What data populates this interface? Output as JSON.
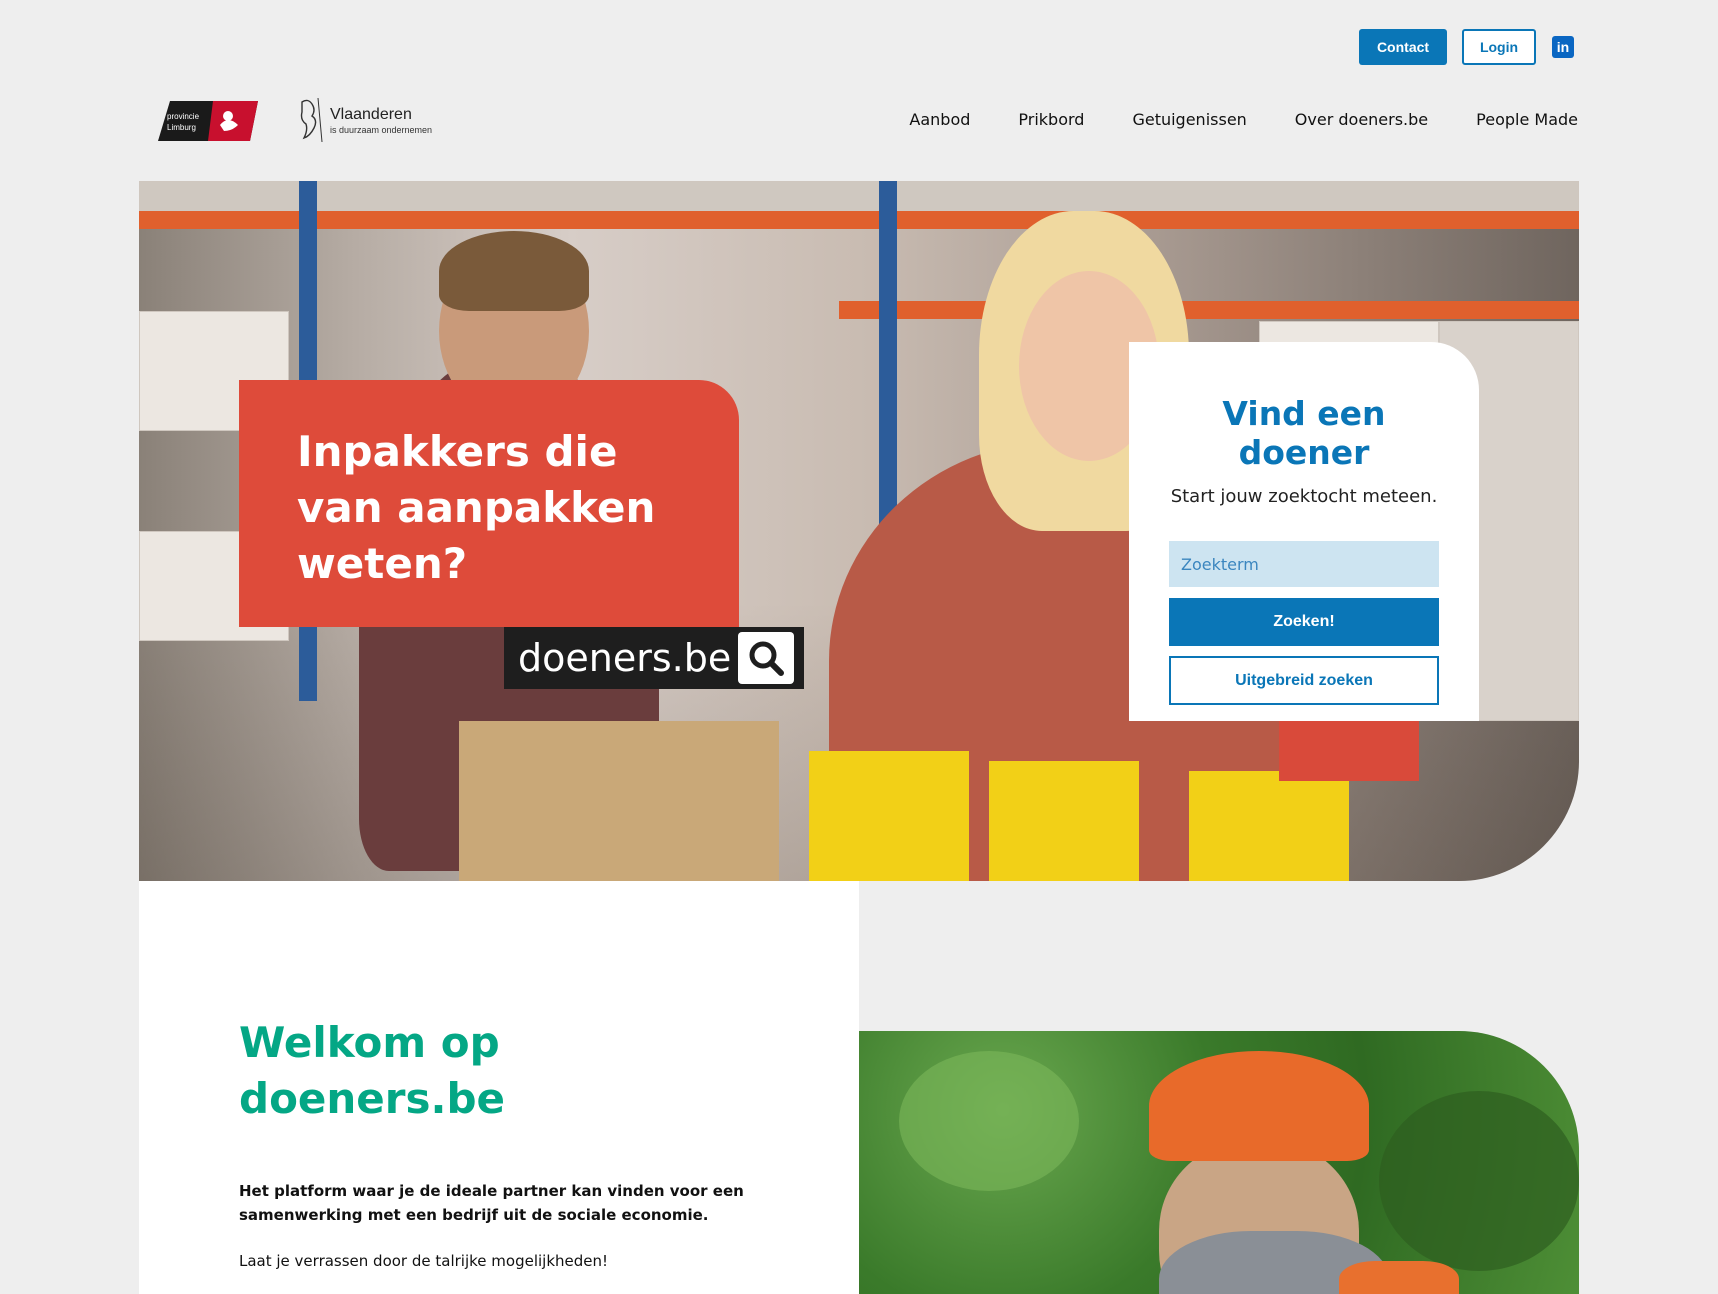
{
  "topbar": {
    "contact_label": "Contact",
    "login_label": "Login",
    "linkedin_glyph": "in"
  },
  "logos": {
    "limburg": {
      "line1": "provincie",
      "line2": "Limburg"
    },
    "vlaanderen": {
      "name": "Vlaanderen",
      "tagline": "is duurzaam ondernemen"
    }
  },
  "nav": {
    "items": [
      "Aanbod",
      "Prikbord",
      "Getuigenissen",
      "Over doeners.be",
      "People Made"
    ]
  },
  "hero": {
    "headline": "Inpakkers die van aanpakken weten?",
    "brand": "doeners.be"
  },
  "search": {
    "title": "Vind een doener",
    "subtitle": "Start jouw zoektocht meteen.",
    "placeholder": "Zoekterm",
    "submit_label": "Zoeken!",
    "advanced_label": "Uitgebreid zoeken"
  },
  "welcome": {
    "title": "Welkom op doeners.be",
    "lead": "Het platform waar je de ideale partner kan vinden voor een samenwerking met een bedrijf uit de sociale economie.",
    "sub": "Laat je verrassen door de talrijke mogelijkheden!"
  },
  "colors": {
    "primary": "#0a76b7",
    "hero_box": "#de4b3a",
    "welcome_title": "#04a785",
    "background": "#eeeeee"
  }
}
